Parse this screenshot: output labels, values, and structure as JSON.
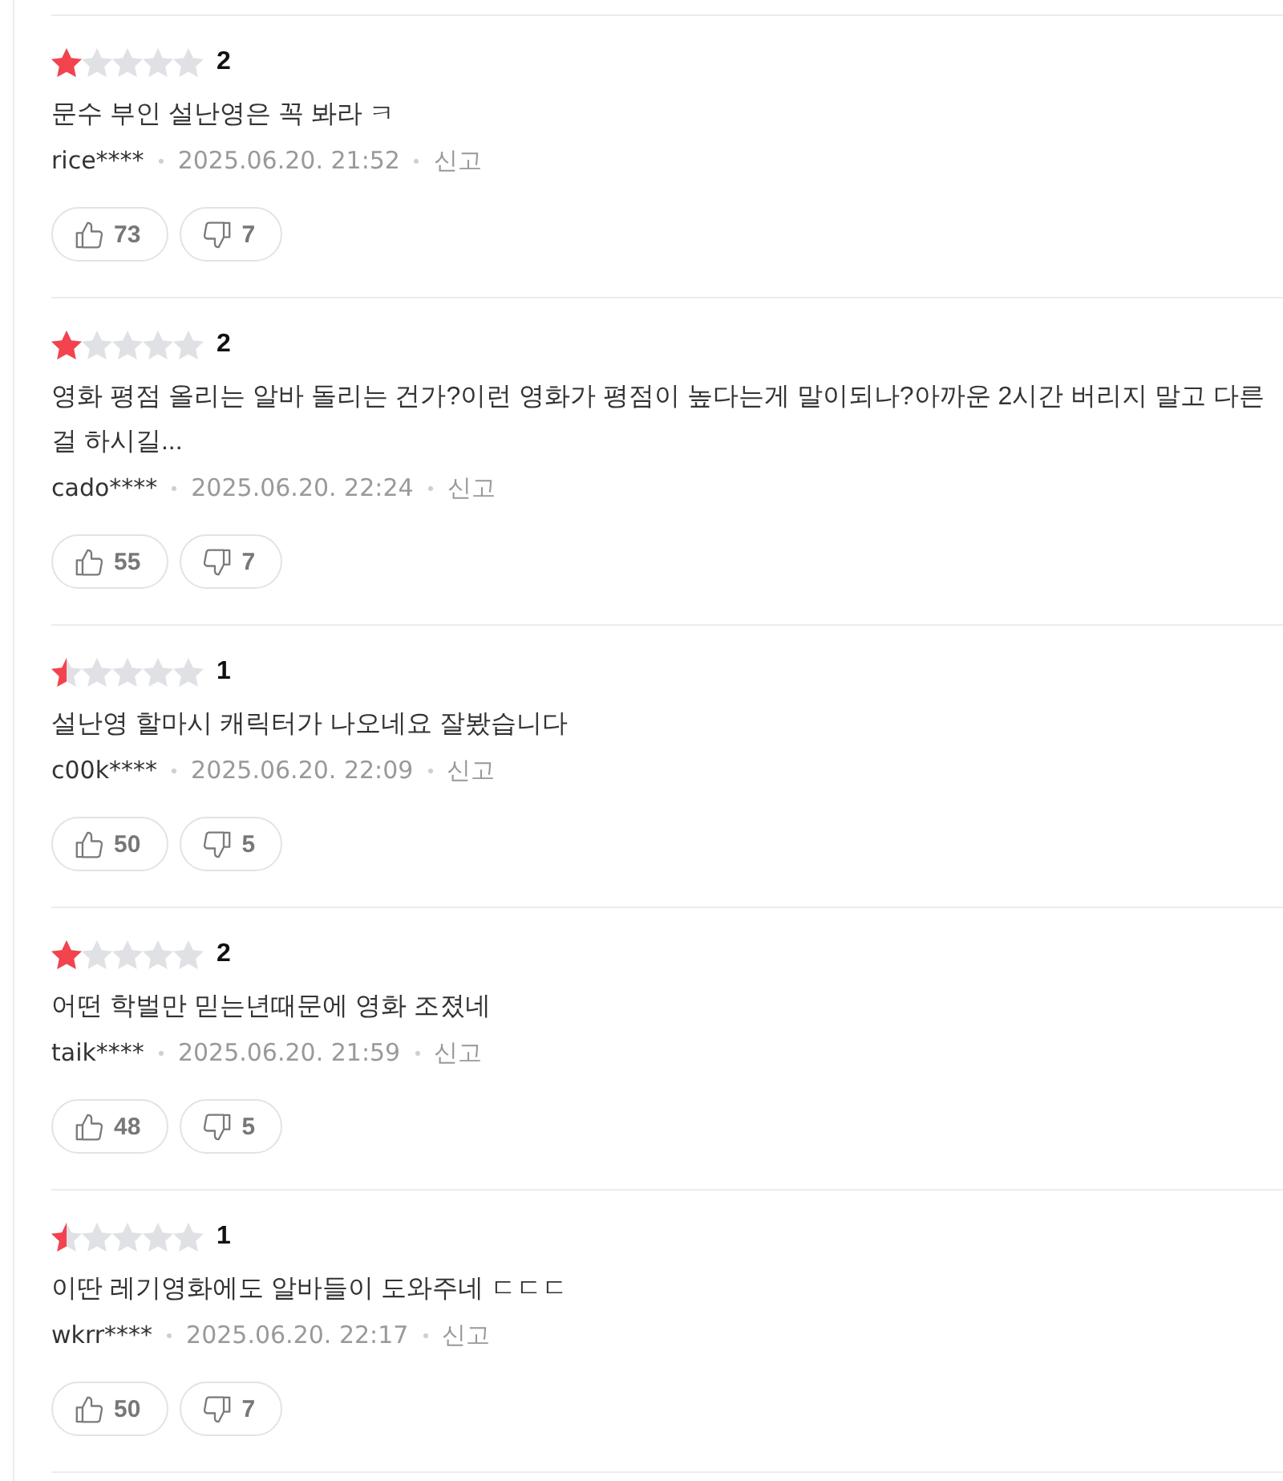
{
  "reviews": [
    {
      "stars": 1,
      "rating": "2",
      "comment": "문수 부인 설난영은 꼭 봐라 ㅋ",
      "user": "rice****",
      "date": "2025.06.20. 21:52",
      "report": "신고",
      "likes": "73",
      "dislikes": "7"
    },
    {
      "stars": 1,
      "rating": "2",
      "comment": "영화 평점 올리는 알바 돌리는 건가?이런 영화가 평점이 높다는게 말이되나?아까운 2시간 버리지 말고 다른 걸 하시길...",
      "user": "cado****",
      "date": "2025.06.20. 22:24",
      "report": "신고",
      "likes": "55",
      "dislikes": "7"
    },
    {
      "stars": 0.5,
      "rating": "1",
      "comment": "설난영 할마시 캐릭터가 나오네요 잘봤습니다",
      "user": "c00k****",
      "date": "2025.06.20. 22:09",
      "report": "신고",
      "likes": "50",
      "dislikes": "5"
    },
    {
      "stars": 1,
      "rating": "2",
      "comment": "어떤 학벌만 믿는년때문에 영화 조졌네",
      "user": "taik****",
      "date": "2025.06.20. 21:59",
      "report": "신고",
      "likes": "48",
      "dislikes": "5"
    },
    {
      "stars": 0.5,
      "rating": "1",
      "comment": "이딴 레기영화에도 알바들이 도와주네 ㄷㄷㄷ",
      "user": "wkrr****",
      "date": "2025.06.20. 22:17",
      "report": "신고",
      "likes": "50",
      "dislikes": "7"
    }
  ]
}
